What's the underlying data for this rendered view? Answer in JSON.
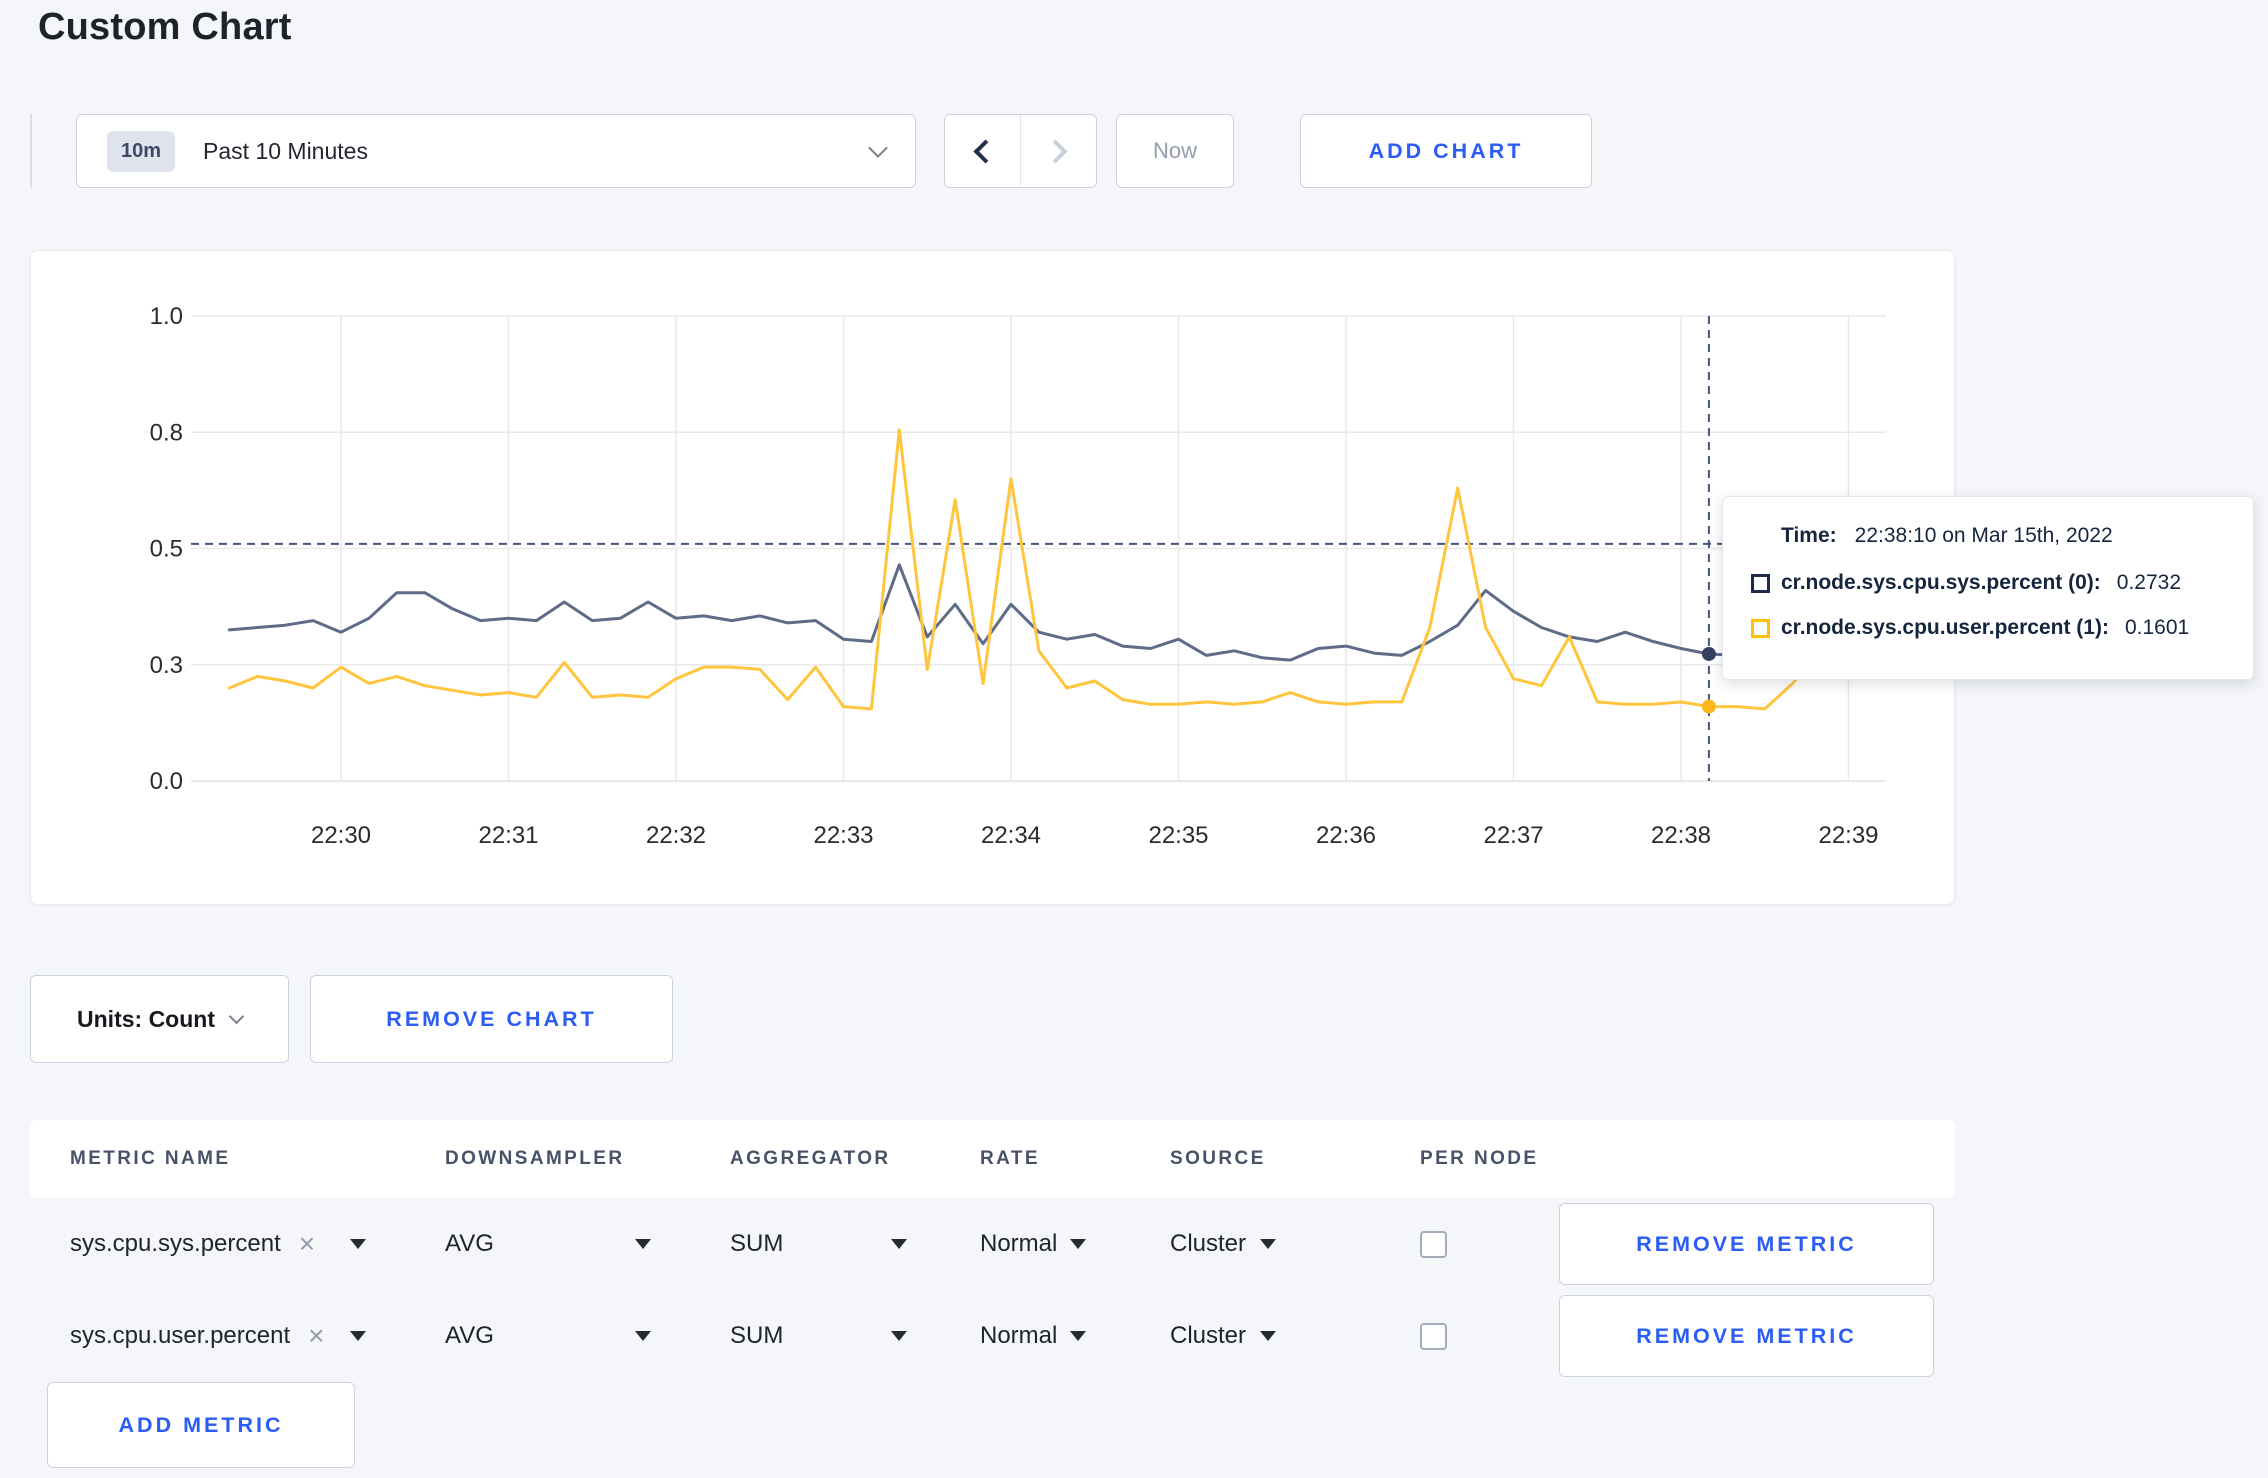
{
  "page": {
    "title": "Custom Chart"
  },
  "toolbar": {
    "time_window_badge": "10m",
    "time_window_label": "Past 10 Minutes",
    "now_label": "Now",
    "add_chart_label": "ADD CHART"
  },
  "controls": {
    "units_label": "Units: Count",
    "remove_chart_label": "REMOVE CHART"
  },
  "tooltip": {
    "time_label": "Time:",
    "time_value": "22:38:10 on Mar 15th, 2022",
    "rows": [
      {
        "label": "cr.node.sys.cpu.sys.percent (0):",
        "value": "0.2732",
        "color": "#1b2b49"
      },
      {
        "label": "cr.node.sys.cpu.user.percent (1):",
        "value": "0.1601",
        "color": "#ffc107"
      }
    ]
  },
  "chart_data": {
    "type": "line",
    "title": "",
    "xlabel": "",
    "ylabel": "",
    "ylim": [
      0,
      1
    ],
    "grid": true,
    "x_start": "22:29:20",
    "x_step_seconds": 10,
    "x_ticks": [
      "22:30",
      "22:31",
      "22:32",
      "22:33",
      "22:34",
      "22:35",
      "22:36",
      "22:37",
      "22:38",
      "22:39"
    ],
    "y_ticks": [
      {
        "value": 0,
        "label": "0.0"
      },
      {
        "value": 0.25,
        "label": "0.3"
      },
      {
        "value": 0.5,
        "label": "0.5"
      },
      {
        "value": 0.75,
        "label": "0.8"
      },
      {
        "value": 1,
        "label": "1.0"
      }
    ],
    "series": [
      {
        "name": "cr.node.sys.cpu.sys.percent (0)",
        "color": "#5f6c87",
        "dot_color": "#33415f",
        "values": [
          0.325,
          0.33,
          0.335,
          0.345,
          0.32,
          0.35,
          0.405,
          0.405,
          0.37,
          0.345,
          0.35,
          0.345,
          0.385,
          0.345,
          0.35,
          0.385,
          0.35,
          0.355,
          0.345,
          0.355,
          0.34,
          0.345,
          0.305,
          0.3,
          0.465,
          0.31,
          0.38,
          0.295,
          0.38,
          0.32,
          0.305,
          0.315,
          0.29,
          0.285,
          0.305,
          0.27,
          0.28,
          0.265,
          0.26,
          0.285,
          0.29,
          0.275,
          0.27,
          0.3,
          0.335,
          0.41,
          0.365,
          0.33,
          0.31,
          0.3,
          0.32,
          0.3,
          0.285,
          0.2732,
          0.27,
          0.275,
          0.28,
          0.285,
          0.29,
          0.3
        ]
      },
      {
        "name": "cr.node.sys.cpu.user.percent (1)",
        "color": "#ffc53d",
        "dot_color": "#fdb81e",
        "values": [
          0.2,
          0.225,
          0.215,
          0.2,
          0.245,
          0.21,
          0.225,
          0.205,
          0.195,
          0.185,
          0.19,
          0.18,
          0.255,
          0.18,
          0.185,
          0.18,
          0.22,
          0.245,
          0.245,
          0.24,
          0.175,
          0.245,
          0.16,
          0.155,
          0.755,
          0.24,
          0.605,
          0.21,
          0.65,
          0.28,
          0.2,
          0.215,
          0.175,
          0.165,
          0.165,
          0.17,
          0.165,
          0.17,
          0.19,
          0.17,
          0.165,
          0.17,
          0.17,
          0.33,
          0.63,
          0.33,
          0.22,
          0.205,
          0.31,
          0.17,
          0.165,
          0.165,
          0.17,
          0.1601,
          0.16,
          0.155,
          0.21,
          0.28,
          0.225,
          0.27
        ]
      }
    ],
    "crosshair": {
      "time": "22:38:10",
      "index": 53,
      "hline_value": 0.51,
      "color": "#44567c"
    },
    "grid_color": "#e9e9e9",
    "axis_text_color": "#2b2b2b",
    "legend_position": "tooltip"
  },
  "metrics_table": {
    "columns": [
      "METRIC NAME",
      "DOWNSAMPLER",
      "AGGREGATOR",
      "RATE",
      "SOURCE",
      "PER NODE"
    ],
    "rows": [
      {
        "metric": "sys.cpu.sys.percent",
        "clear": "×",
        "downsampler": "AVG",
        "aggregator": "SUM",
        "rate": "Normal",
        "source": "Cluster",
        "per_node": false,
        "remove_label": "REMOVE METRIC"
      },
      {
        "metric": "sys.cpu.user.percent",
        "clear": "×",
        "downsampler": "AVG",
        "aggregator": "SUM",
        "rate": "Normal",
        "source": "Cluster",
        "per_node": false,
        "remove_label": "REMOVE METRIC"
      }
    ],
    "add_metric_label": "ADD METRIC"
  }
}
